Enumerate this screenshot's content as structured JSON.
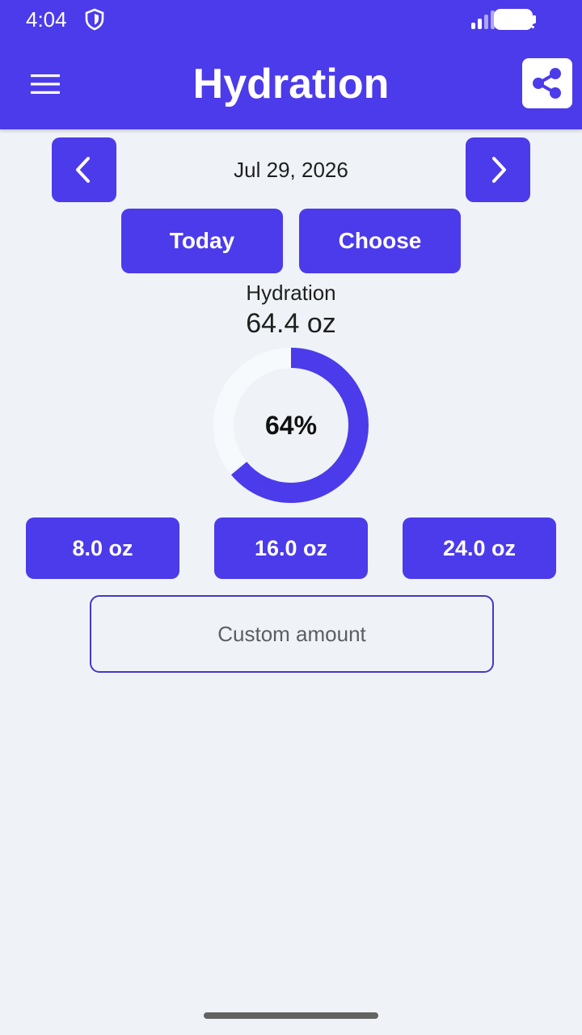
{
  "status_bar": {
    "time": "4:04",
    "icons": [
      "shield-icon",
      "signal-icon",
      "wifi-icon",
      "battery-icon"
    ]
  },
  "app_bar": {
    "title": "Hydration",
    "menu_icon": "hamburger-menu-icon",
    "share_icon": "share-icon"
  },
  "date_nav": {
    "prev_icon": "chevron-left-icon",
    "next_icon": "chevron-right-icon",
    "date": "Jul 29, 2026",
    "today_label": "Today",
    "choose_label": "Choose"
  },
  "summary": {
    "title": "Hydration",
    "value": "64.4 oz",
    "percent_label": "64%",
    "percent": 0.64
  },
  "quick_add": [
    {
      "label": "8.0 oz"
    },
    {
      "label": "16.0 oz"
    },
    {
      "label": "24.0 oz"
    }
  ],
  "custom_amount": {
    "placeholder": "Custom amount",
    "value": ""
  },
  "colors": {
    "primary": "#4c3bea",
    "background": "#eff3f8",
    "ring_track": "#f7fafc",
    "text": "#1f1f1f"
  }
}
